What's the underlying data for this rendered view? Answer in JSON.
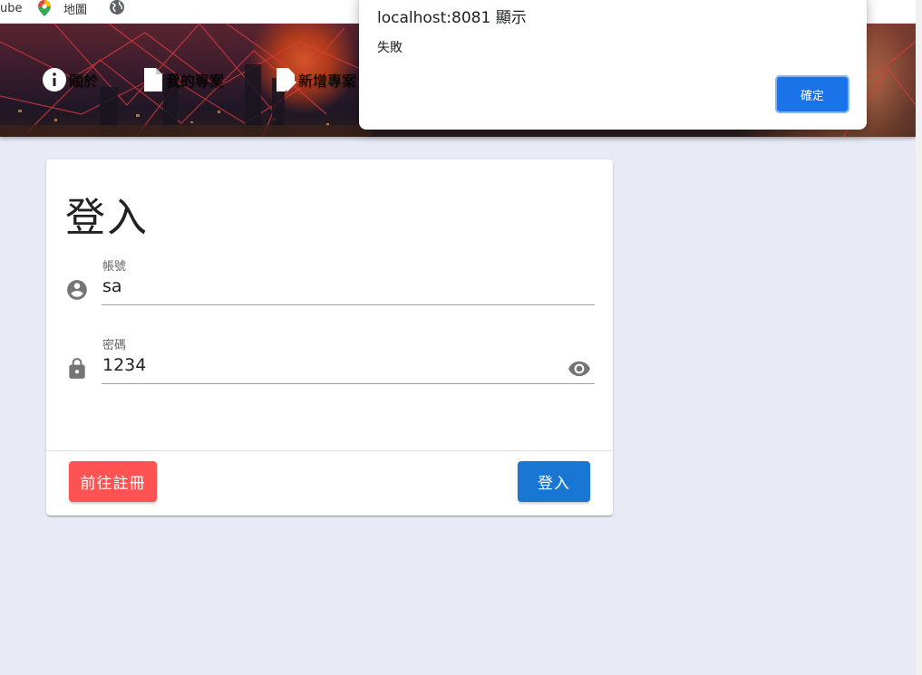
{
  "bookmarks": {
    "youtube_label": "ube",
    "maps_label": "地圖"
  },
  "nav": {
    "items": [
      {
        "label": "",
        "icon": "home-icon"
      },
      {
        "label": "關於",
        "icon": "info-icon"
      },
      {
        "label": "我的專案",
        "icon": "document-icon"
      },
      {
        "label": "新增專案",
        "icon": "edit-document-icon"
      }
    ]
  },
  "login": {
    "title": "登入",
    "account_label": "帳號",
    "account_value": "sa",
    "password_label": "密碼",
    "password_value": "1234",
    "register_button": "前往註冊",
    "login_button": "登入"
  },
  "dialog": {
    "title": "localhost:8081 顯示",
    "message": "失敗",
    "ok_button": "確定"
  },
  "colors": {
    "page_bg": "#e8eaf6",
    "register": "#ff5252",
    "login": "#1976d2",
    "dialog_ok": "#1a73e8"
  }
}
